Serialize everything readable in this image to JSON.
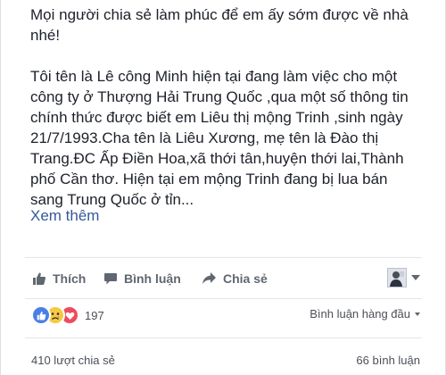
{
  "post": {
    "paragraph1": "Mọi người chia sẻ làm phúc để em ấy sớm được về nhà nhé!",
    "paragraph2": "Tôi tên là Lê công Minh hiện tại đang làm việc cho một công ty ở Thượng Hải Trung Quốc ,qua một số thông tin chính thức được biết em Liêu thị mộng Trinh ,sinh ngày 21/7/1993.Cha tên là Liêu Xương, mẹ tên là Đào thị Trang.ĐC Ấp Điền Hoa,xã thới tân,huyện thới lai,Thành phố Cần thơ. Hiện tại em mộng Trinh đang bị lua bán sang Trung Quốc ở tỉn...",
    "see_more": "Xem thêm"
  },
  "actions": {
    "like_label": "Thích",
    "comment_label": "Bình luận",
    "share_label": "Chia sẻ"
  },
  "reactions": {
    "types": [
      "like-icon",
      "sad-icon",
      "love-icon"
    ],
    "count": "197"
  },
  "comments_sort": {
    "label": "Bình luận hàng đầu"
  },
  "footer": {
    "shares": "410 lượt chia sẻ",
    "comments": "66 bình luận"
  },
  "colors": {
    "text": "#1d2129",
    "link": "#365899",
    "secondary": "#606770",
    "like_blue": "#4a7fe8",
    "sad_yellow": "#f6c945",
    "love_red": "#ef4b5e"
  }
}
